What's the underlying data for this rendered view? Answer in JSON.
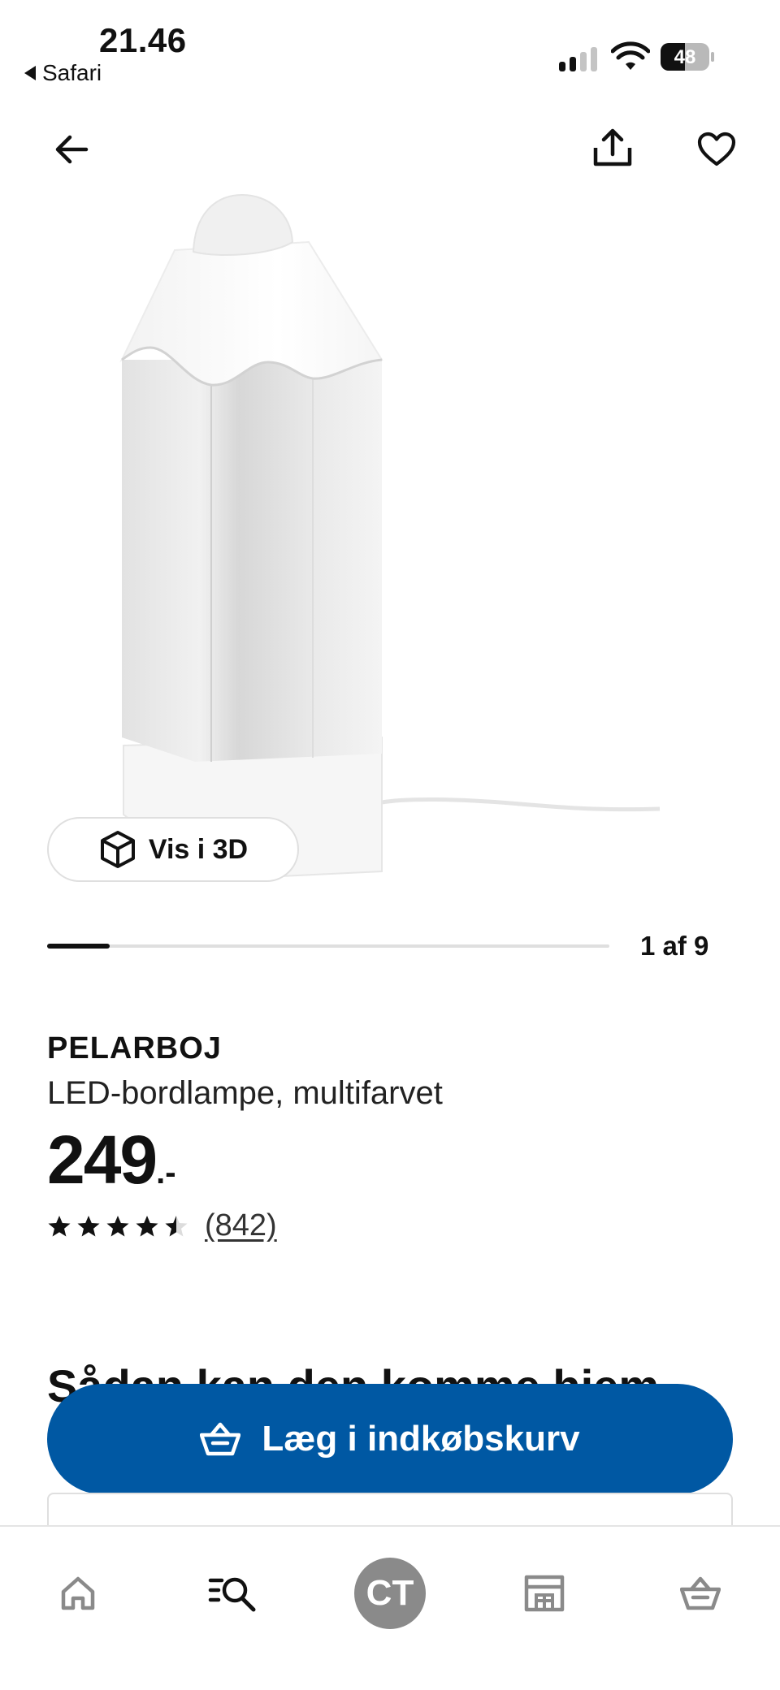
{
  "status_bar": {
    "time": "21.46",
    "back_app": "Safari",
    "battery": "48",
    "signal_bars_active": 2,
    "signal_bars_total": 4
  },
  "top_nav": {
    "back_icon": "arrow-left-icon",
    "share_icon": "share-icon",
    "favorite_icon": "heart-icon"
  },
  "gallery": {
    "view_3d_label": "Vis i 3D",
    "view_3d_icon": "cube-icon",
    "current": 1,
    "total": 9,
    "counter_text": "1 af 9"
  },
  "product": {
    "name": "PELARBOJ",
    "description": "LED-bordlampe, multifarvet",
    "price_integer": "249",
    "price_suffix": ".-",
    "rating": 4.5,
    "rating_max": 5,
    "review_count": "(842)"
  },
  "delivery_section": {
    "heading": "Sådan kan den komme hjem"
  },
  "cta": {
    "label": "Læg i indkøbskurv",
    "icon": "basket-icon",
    "color": "#0058a3"
  },
  "tab_bar": {
    "items": [
      {
        "icon": "home-icon"
      },
      {
        "icon": "search-icon"
      },
      {
        "avatar_initials": "CT"
      },
      {
        "icon": "store-icon"
      },
      {
        "icon": "basket-icon"
      }
    ]
  }
}
